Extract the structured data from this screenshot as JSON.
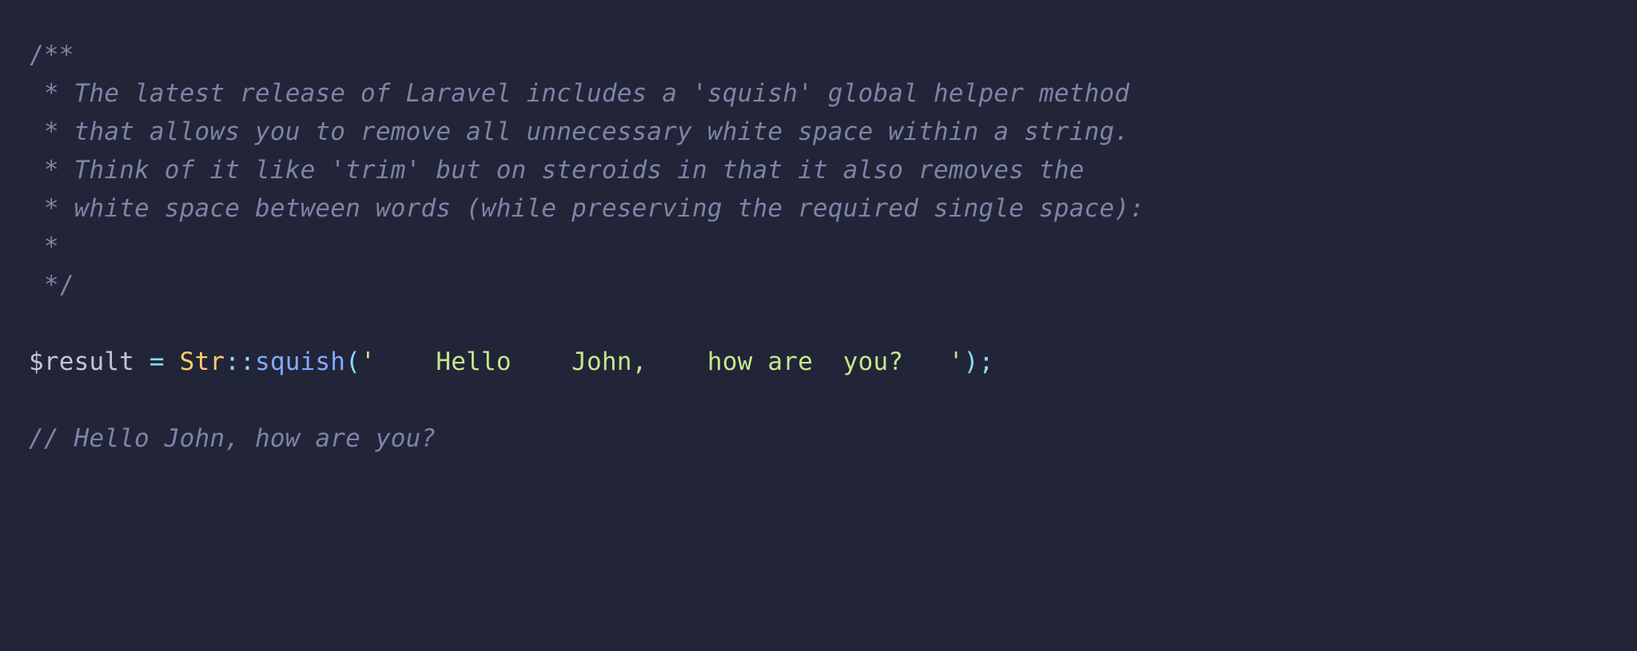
{
  "code": {
    "doc_open": "/**",
    "doc_lines": [
      "The latest release of Laravel includes a 'squish' global helper method",
      "that allows you to remove all unnecessary white space within a string.",
      "Think of it like 'trim' but on steroids in that it also removes the",
      "white space between words (while preserving the required single space):"
    ],
    "doc_close": "*/",
    "star": " *",
    "variable": "$result",
    "equals": " = ",
    "class": "Str",
    "scope": "::",
    "method": "squish",
    "paren_open": "(",
    "string_open": "'",
    "string_body": "    Hello    John,    how are  you?   ",
    "string_close": "'",
    "paren_close": ")",
    "semicolon": ";",
    "line_comment": "// Hello John, how are you?"
  }
}
